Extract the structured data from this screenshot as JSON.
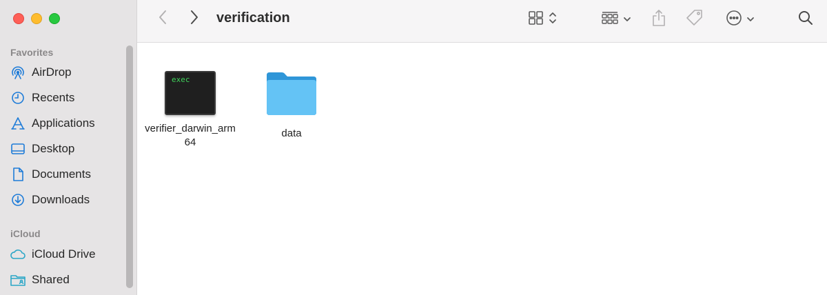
{
  "window": {
    "title": "verification"
  },
  "sidebar": {
    "sections": [
      {
        "title": "Favorites",
        "items": [
          {
            "label": "AirDrop",
            "icon": "airdrop-icon"
          },
          {
            "label": "Recents",
            "icon": "clock-icon"
          },
          {
            "label": "Applications",
            "icon": "applications-icon"
          },
          {
            "label": "Desktop",
            "icon": "desktop-icon"
          },
          {
            "label": "Documents",
            "icon": "document-icon"
          },
          {
            "label": "Downloads",
            "icon": "download-icon"
          }
        ]
      },
      {
        "title": "iCloud",
        "items": [
          {
            "label": "iCloud Drive",
            "icon": "cloud-icon"
          },
          {
            "label": "Shared",
            "icon": "shared-folder-icon"
          }
        ]
      }
    ]
  },
  "toolbar": {
    "buttons": [
      "back-icon",
      "forward-icon",
      "grid-view-icon",
      "group-icon",
      "share-icon",
      "tag-icon",
      "more-icon",
      "search-icon"
    ]
  },
  "files": [
    {
      "name": "verifier_darwin_arm64",
      "kind": "exec",
      "badge": "exec"
    },
    {
      "name": "data",
      "kind": "folder"
    }
  ],
  "colors": {
    "sidebar_bg": "#e6e4e5",
    "accent": "#1d7bd8",
    "icloud_accent": "#2aa6c7",
    "folder_light": "#64c3f5",
    "folder_dark": "#2f96d8",
    "exec_text": "#3fd25b"
  }
}
